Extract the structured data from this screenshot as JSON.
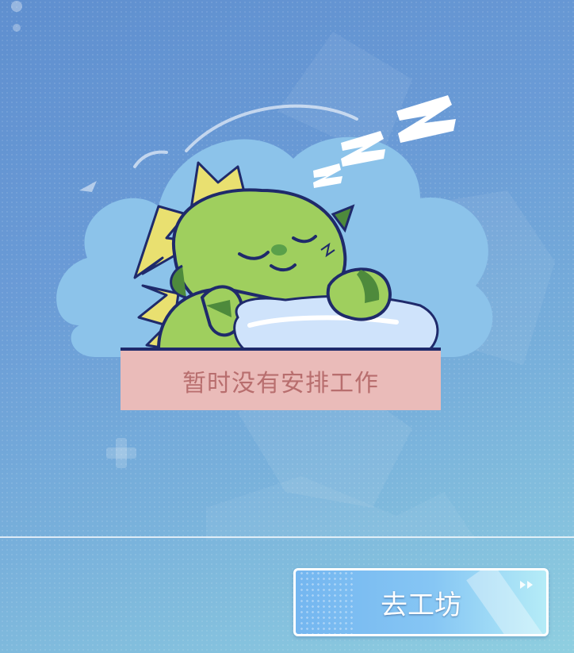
{
  "screen": {
    "message": "暂时没有安排工作",
    "button_label": "去工坊"
  },
  "icons": {
    "illustration": "sleeping-green-dinosaur-on-cloud",
    "sleep_zzz": "zzz-icon",
    "button_arrows": "fast-forward-icon"
  },
  "colors": {
    "background": "#6a9bd6",
    "banner": "#eabbb9",
    "banner_text": "#b86e6e",
    "button": "#86c6f4",
    "dino": "#9fcf5e",
    "cloud": "#8cc3ea"
  }
}
